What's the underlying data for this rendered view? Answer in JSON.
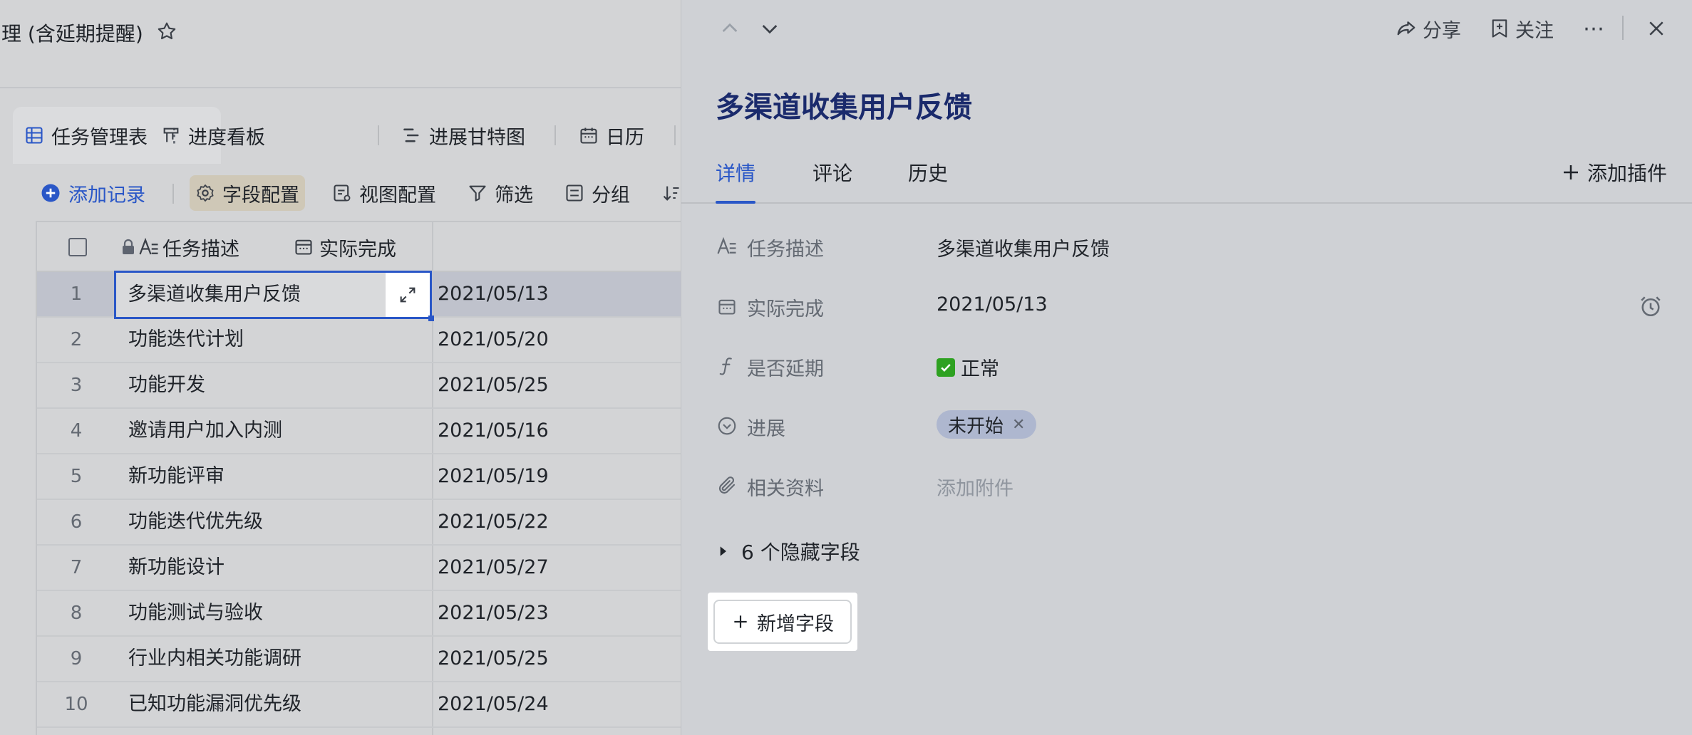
{
  "doc_title": "理 (含延期提醒)",
  "view_tabs": [
    {
      "label": "任务管理表",
      "icon": "grid-table-icon"
    },
    {
      "label": "进度看板",
      "icon": "kanban-icon"
    },
    {
      "label": "进展甘特图",
      "icon": "gantt-icon"
    },
    {
      "label": "日历",
      "icon": "calendar-icon"
    }
  ],
  "toolbar": {
    "add_record": "添加记录",
    "field_config": "字段配置",
    "view_config": "视图配置",
    "filter": "筛选",
    "group": "分组"
  },
  "grid": {
    "columns": [
      "任务描述",
      "实际完成"
    ],
    "rows": [
      {
        "n": "1",
        "task": "多渠道收集用户反馈",
        "date": "2021/05/13"
      },
      {
        "n": "2",
        "task": "功能迭代计划",
        "date": "2021/05/20"
      },
      {
        "n": "3",
        "task": "功能开发",
        "date": "2021/05/25"
      },
      {
        "n": "4",
        "task": "邀请用户加入内测",
        "date": "2021/05/16"
      },
      {
        "n": "5",
        "task": "新功能评审",
        "date": "2021/05/19"
      },
      {
        "n": "6",
        "task": "功能迭代优先级",
        "date": "2021/05/22"
      },
      {
        "n": "7",
        "task": "新功能设计",
        "date": "2021/05/27"
      },
      {
        "n": "8",
        "task": "功能测试与验收",
        "date": "2021/05/23"
      },
      {
        "n": "9",
        "task": "行业内相关功能调研",
        "date": "2021/05/25"
      },
      {
        "n": "10",
        "task": "已知功能漏洞优先级",
        "date": "2021/05/24"
      }
    ]
  },
  "panel": {
    "share": "分享",
    "follow": "关注",
    "title": "多渠道收集用户反馈",
    "tabs": [
      "详情",
      "评论",
      "历史"
    ],
    "add_plugin": "添加插件",
    "fields": [
      {
        "label": "任务描述",
        "value": "多渠道收集用户反馈"
      },
      {
        "label": "实际完成",
        "value": "2021/05/13"
      },
      {
        "label": "是否延期",
        "value": "正常"
      },
      {
        "label": "进展",
        "value": "未开始"
      },
      {
        "label": "相关资料",
        "value": "添加附件"
      }
    ],
    "hidden_fields": "6 个隐藏字段",
    "new_field": "新增字段"
  },
  "colors": {
    "accent": "#2a57c7",
    "title": "#1a2a6c",
    "check": "#2ea121",
    "chip": "#aeb7cf"
  }
}
